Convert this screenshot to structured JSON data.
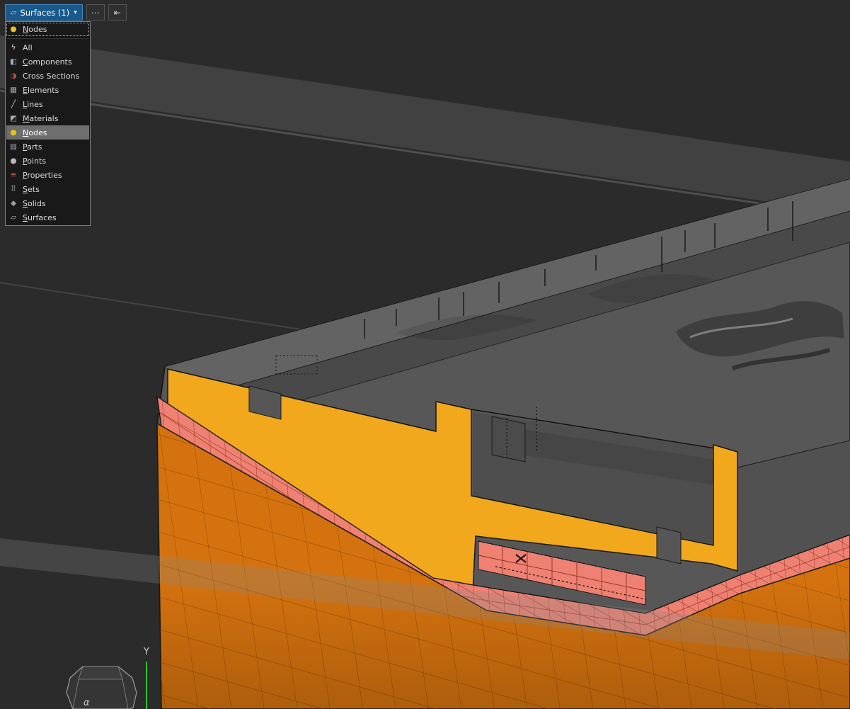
{
  "toolbar": {
    "entity_selector": {
      "icon": "▱",
      "label": "Surfaces (1)",
      "chevron": "▾"
    },
    "more_label": "⋯",
    "isolate_label": "⇤"
  },
  "dropdown": {
    "pinned": {
      "icon": "●",
      "icon_color": "#e8c020",
      "label": "Nodes",
      "mnemonic": "N"
    },
    "items": [
      {
        "icon": "ϟ",
        "icon_color": "#d8d8d8",
        "label": "All",
        "mnemonic": null,
        "selected": false
      },
      {
        "icon": "◧",
        "icon_color": "#9fb0c2",
        "label": "Components",
        "mnemonic": "C",
        "selected": false
      },
      {
        "icon": "◑",
        "icon_color": "#b05844",
        "label": "Cross Sections",
        "mnemonic": null,
        "selected": false
      },
      {
        "icon": "▦",
        "icon_color": "#9ab0c4",
        "label": "Elements",
        "mnemonic": "E",
        "selected": false
      },
      {
        "icon": "╱",
        "icon_color": "#cccccc",
        "label": "Lines",
        "mnemonic": "L",
        "selected": false
      },
      {
        "icon": "◩",
        "icon_color": "#a2b5a6",
        "label": "Materials",
        "mnemonic": "M",
        "selected": false
      },
      {
        "icon": "●",
        "icon_color": "#e8c020",
        "label": "Nodes",
        "mnemonic": "N",
        "selected": true
      },
      {
        "icon": "▤",
        "icon_color": "#a8b6c2",
        "label": "Parts",
        "mnemonic": "P",
        "selected": false
      },
      {
        "icon": "●",
        "icon_color": "#b8b8b8",
        "label": "Points",
        "mnemonic": "P",
        "selected": false
      },
      {
        "icon": "≡",
        "icon_color": "#c06050",
        "label": "Properties",
        "mnemonic": "P",
        "selected": false
      },
      {
        "icon": "⠿",
        "icon_color": "#b8b8b8",
        "label": "Sets",
        "mnemonic": "S",
        "selected": false
      },
      {
        "icon": "◆",
        "icon_color": "#97a1ab",
        "label": "Solids",
        "mnemonic": "S",
        "selected": false
      },
      {
        "icon": "▱",
        "icon_color": "#aab2ba",
        "label": "Surfaces",
        "mnemonic": "S",
        "selected": false
      }
    ]
  },
  "viewport": {
    "y_axis_label": "Y",
    "view_cube_label": "α",
    "colors": {
      "background": "#2b2b2b",
      "die_gray": "#575757",
      "flange_yellow": "#f2a81d",
      "rim_salmon": "#ee8172",
      "blank_orange": "#d4720f",
      "axis_green": "#2ec22e"
    }
  }
}
